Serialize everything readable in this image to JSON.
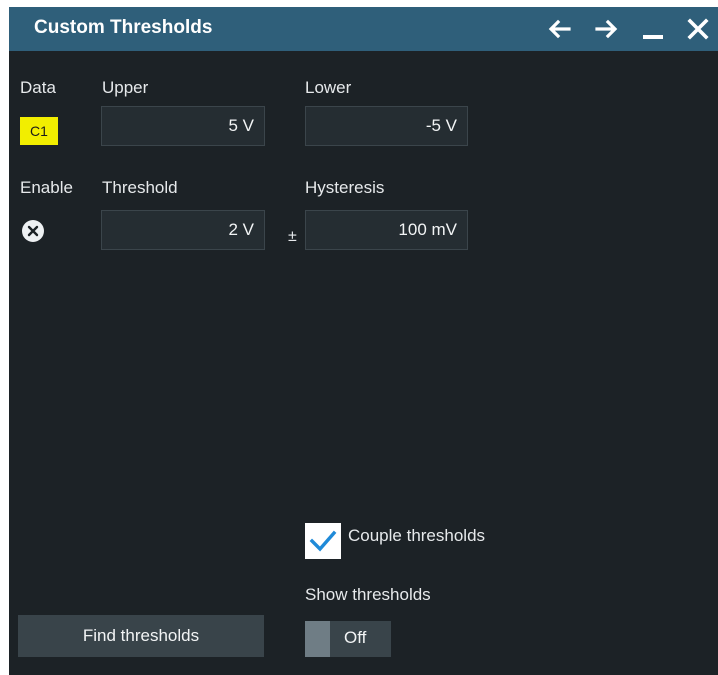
{
  "dialog": {
    "title": "Custom Thresholds"
  },
  "titlebar_icons": [
    "arrow-left-icon",
    "arrow-right-icon",
    "minimize-icon",
    "close-icon"
  ],
  "data_section": {
    "data_label": "Data",
    "channel": "C1",
    "upper_label": "Upper",
    "upper_value": "5 V",
    "lower_label": "Lower",
    "lower_value": "-5 V"
  },
  "threshold_section": {
    "enable_label": "Enable",
    "threshold_label": "Threshold",
    "threshold_value": "2 V",
    "plus_minus": "±",
    "hysteresis_label": "Hysteresis",
    "hysteresis_value": "100 mV"
  },
  "couple": {
    "checked": true,
    "label": "Couple thresholds"
  },
  "show_thresholds": {
    "label": "Show thresholds",
    "state": "Off"
  },
  "find_button": {
    "label": "Find thresholds"
  },
  "colors": {
    "titlebar": "#2f5f7a",
    "background": "#1c2226",
    "channel_badge": "#f2ee00",
    "checkmark": "#1f8ad8"
  }
}
